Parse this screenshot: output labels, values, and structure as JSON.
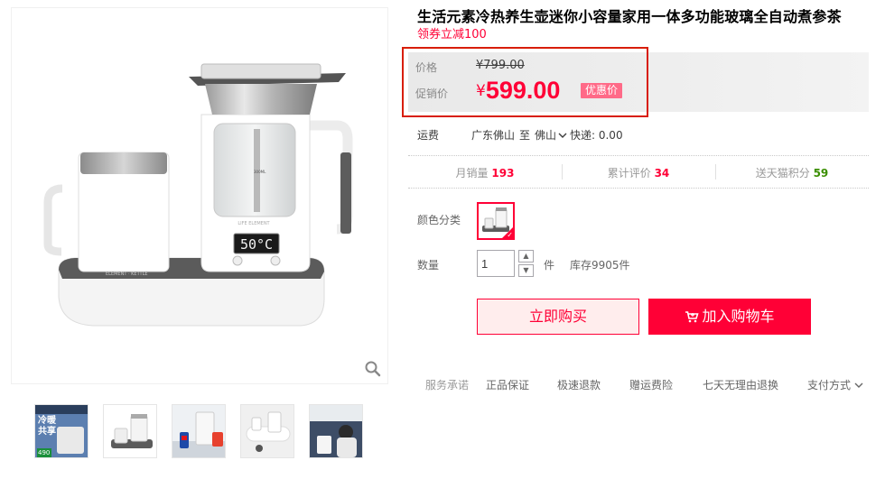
{
  "product": {
    "title": "生活元素冷热养生壶迷你小容量家用一体多功能玻璃全自动煮参茶",
    "subtitle": "领券立减100"
  },
  "price": {
    "original_label": "价格",
    "original_value": "¥799.00",
    "promo_label": "促销价",
    "promo_currency": "¥",
    "promo_value": "599.00",
    "promo_tag": "优惠价"
  },
  "shipping": {
    "label": "运费",
    "from": "广东佛山",
    "to_word": "至",
    "to": "佛山",
    "express": "快递: 0.00"
  },
  "stats": [
    {
      "label": "月销量",
      "value": "193"
    },
    {
      "label": "累计评价",
      "value": "34"
    },
    {
      "label": "送天猫积分",
      "value": "59"
    }
  ],
  "options": {
    "color_label": "颜色分类",
    "quantity_label": "数量",
    "quantity_value": "1",
    "unit": "件",
    "stock": "库存9905件"
  },
  "actions": {
    "buy_now": "立即购买",
    "add_cart": "加入购物车"
  },
  "services": {
    "label": "服务承诺",
    "items": [
      "正品保证",
      "极速退款",
      "赠运费险",
      "七天无理由退换"
    ],
    "payment": "支付方式"
  },
  "thumbnails": {
    "first_text_1": "冷暖",
    "first_text_2": "共享",
    "first_badge": "490"
  },
  "device_display": "50°C",
  "colors": {
    "accent": "#ff0036",
    "stat_193": "#ff0036",
    "stat_34": "#ff0036",
    "stat_59": "#3a8e00"
  }
}
